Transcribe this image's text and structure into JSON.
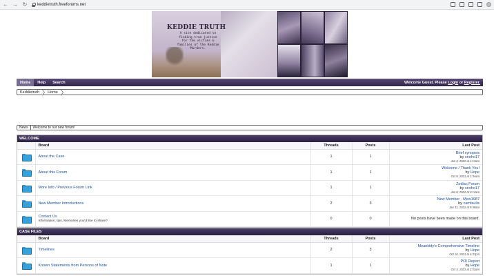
{
  "browser": {
    "url": "keddietruth.freeforums.net"
  },
  "banner": {
    "title": "KEDDIE TRUTH",
    "tagline": "A site dedicated to finding true justice for the victims & families of the Keddie Murders."
  },
  "nav": {
    "items": [
      {
        "label": "Home",
        "active": true
      },
      {
        "label": "Help",
        "active": false
      },
      {
        "label": "Search",
        "active": false
      }
    ],
    "guest_prefix": "Welcome Guest. Please",
    "login": "Login",
    "or": "or",
    "register": "Register."
  },
  "breadcrumb": [
    "Keddietruth",
    "Home"
  ],
  "news": {
    "label": "News",
    "message": "Welcome to our new forum!"
  },
  "columns": {
    "board": "Board",
    "threads": "Threads",
    "posts": "Posts",
    "last_post": "Last Post"
  },
  "categories": [
    {
      "title": "WELCOME",
      "boards": [
        {
          "name": "About the Case",
          "threads": "1",
          "posts": "1",
          "last": {
            "title": "Brief synopsis",
            "by": "by",
            "user": "snoho17",
            "date": "Jan 3, 2022 at 1:13am"
          }
        },
        {
          "name": "About this Forum",
          "threads": "1",
          "posts": "1",
          "last": {
            "title": "Welcome / Thank You!",
            "by": "by",
            "user": "Hope",
            "date": "Oct 9, 2021 at 1:34am"
          }
        },
        {
          "name": "More Info / Previous Forum Link",
          "threads": "1",
          "posts": "1",
          "last": {
            "title": "Zodiac Forum",
            "by": "by",
            "user": "snoho17",
            "date": "Jan 8, 2022 at 2:12am"
          }
        },
        {
          "name": "New Member Introductions",
          "threads": "2",
          "posts": "3",
          "last": {
            "title": "New Member - Mew1987",
            "by": "by",
            "user": "camfaults",
            "date": "Jan 31, 2022 at 9:48am"
          }
        },
        {
          "name": "Contact Us",
          "desc": "Information, tips, Memories you'd like to share?",
          "threads": "0",
          "posts": "0",
          "empty": "No posts have been made on this board."
        }
      ]
    },
    {
      "title": "CASE FILES",
      "boards": [
        {
          "name": "Timelines",
          "threads": "2",
          "posts": "3",
          "last": {
            "title": "Meankitty's Comprehensive Timeline",
            "by": "by",
            "user": "Hope",
            "date": "Oct 10, 2021 at 4:37pm"
          }
        },
        {
          "name": "Known Statements from Persons of Note",
          "threads": "1",
          "posts": "1",
          "last": {
            "title": "POI Report",
            "by": "by",
            "user": "Hope",
            "date": "Oct 3, 2021 at 2:53am"
          }
        }
      ]
    }
  ],
  "colors": {
    "navbar": "#2f2448",
    "link": "#1d4f96",
    "folder": "#36a2dc"
  }
}
